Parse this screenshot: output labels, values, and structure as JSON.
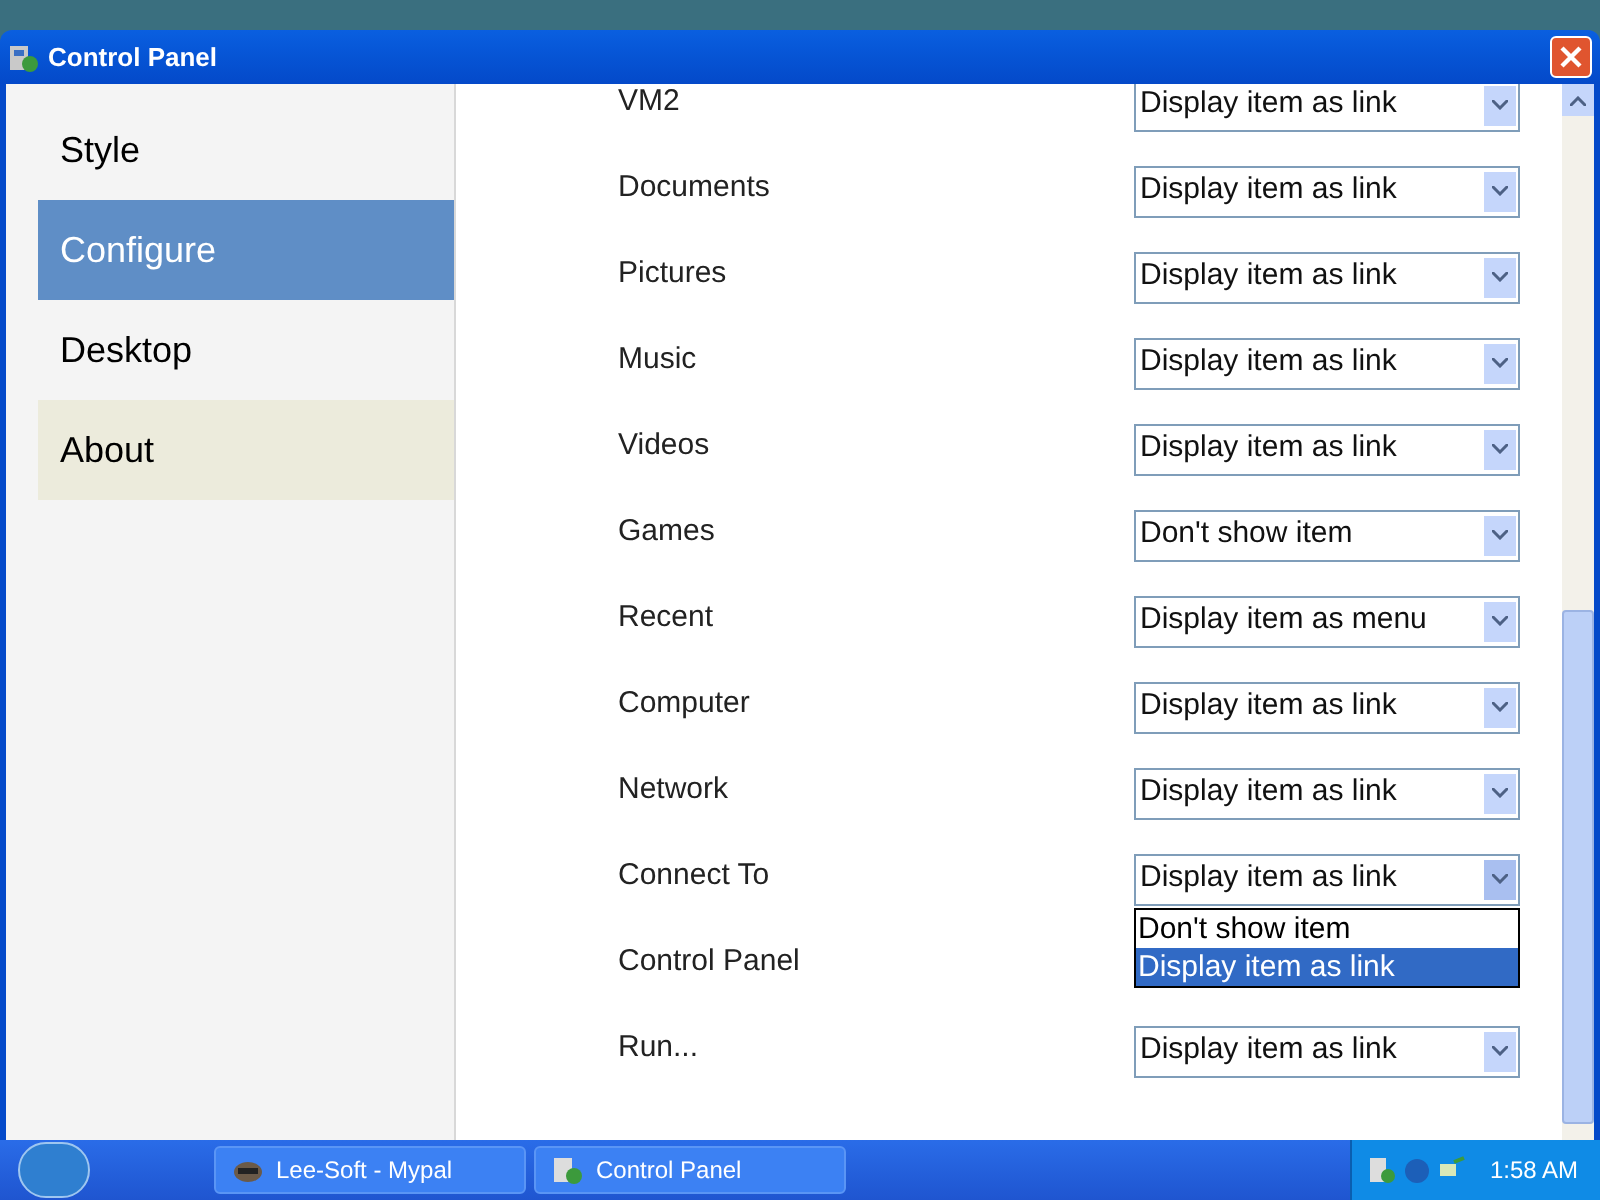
{
  "window": {
    "title": "Control Panel"
  },
  "sidebar": {
    "items": [
      {
        "label": "Style",
        "selected": false,
        "hovered": false
      },
      {
        "label": "Configure",
        "selected": true,
        "hovered": false
      },
      {
        "label": "Desktop",
        "selected": false,
        "hovered": false
      },
      {
        "label": "About",
        "selected": false,
        "hovered": true
      }
    ]
  },
  "settings": [
    {
      "label": "VM2",
      "value": "Display item as link"
    },
    {
      "label": "Documents",
      "value": "Display item as link"
    },
    {
      "label": "Pictures",
      "value": "Display item as link"
    },
    {
      "label": "Music",
      "value": "Display item as link"
    },
    {
      "label": "Videos",
      "value": "Display item as link"
    },
    {
      "label": "Games",
      "value": "Don't show item"
    },
    {
      "label": "Recent",
      "value": "Display item as menu"
    },
    {
      "label": "Computer",
      "value": "Display item as link"
    },
    {
      "label": "Network",
      "value": "Display item as link"
    },
    {
      "label": "Connect To",
      "value": "Display item as link",
      "open": true,
      "options": [
        {
          "label": "Don't show item",
          "selected": false
        },
        {
          "label": "Display item as link",
          "selected": true
        }
      ]
    },
    {
      "label": "Control Panel"
    },
    {
      "label": "Run...",
      "value": "Display item as link"
    }
  ],
  "taskbar": {
    "buttons": [
      {
        "label": "Lee-Soft - Mypal",
        "kind": "browser"
      },
      {
        "label": "Control Panel",
        "kind": "panel"
      }
    ],
    "clock": "1:58 AM"
  }
}
